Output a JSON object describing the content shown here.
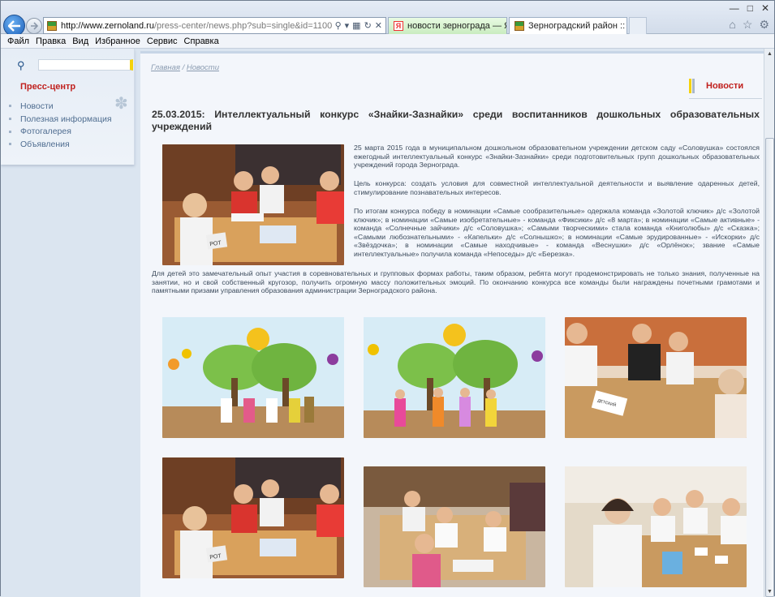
{
  "browser": {
    "url_host": "http://www.zernoland.ru",
    "url_path": "/press-center/news.php?sub=single&id=1100",
    "tabs": [
      {
        "label": "новости зернограда — Яндек...",
        "icon": "yandex-icon"
      },
      {
        "label": "Зерноградский район :: Н...",
        "icon": "site-favicon"
      }
    ],
    "menu": [
      "Файл",
      "Правка",
      "Вид",
      "Избранное",
      "Сервис",
      "Справка"
    ]
  },
  "sidebar": {
    "section_title": "Пресс-центр",
    "items": [
      "Новости",
      "Полезная информация",
      "Фотогалерея",
      "Объявления"
    ]
  },
  "breadcrumb": {
    "home": "Главная",
    "sep": " / ",
    "current": "Новости"
  },
  "section_label": "Новости",
  "article": {
    "title": "25.03.2015: Интеллектуальный конкурс «Знайки-Зазнайки» среди воспитанников дошкольных образовательных учреждений",
    "p1": "25 марта 2015 года в муниципальном дошкольном образовательном учреждении детском саду «Соловушка» состоялся ежегодный интеллектуальный конкурс «Знайки-Зазнайки» среди подготовительных групп дошкольных образовательных учреждений города Зернограда.",
    "p2": "Цель конкурса: создать условия для совместной интеллектуальной деятельности и выявление одаренных детей, стимулирование познавательных интересов.",
    "p3": "По итогам конкурса победу в номинации «Самые сообразительные» одержала команда «Золотой ключик» д/с «Золотой ключик»; в номинации «Самые изобретательные» - команда «Фиксики» д/с «8 марта»; в номинации «Самые активные» - команда «Солнечные зайчики» д/с «Соловушка»; «Самыми творческими» стала команда «Книголюбы» д/с «Сказка»; «Самыми любознательными» - «Капельки» д/с «Солнышко»; в номинации «Самые эрудированные» - «Искорки» д/с «Звёздочка»; в номинации «Самые находчивые» - команда «Веснушки» д/с «Орлёнок»; звание «Самые интеллектуальные» получила команда «Непоседы» д/с «Березка».",
    "p4": "Для детей это замечательный опыт участия в соревновательных и групповых формах работы, таким образом, ребята могут продемонстрировать не только знания, полученные на занятии, но и свой собственный кругозор, получить огромную массу положительных эмоций. По окончанию конкурса все команды были награждены почетными грамотами и памятными призами управления образования администрации Зерноградского района."
  },
  "photo_labels": {
    "tent": "РОТ",
    "card": "ДЕТСКИЙ"
  },
  "colors": {
    "accent_red": "#c0201d",
    "link_blue": "#4f6d90"
  }
}
